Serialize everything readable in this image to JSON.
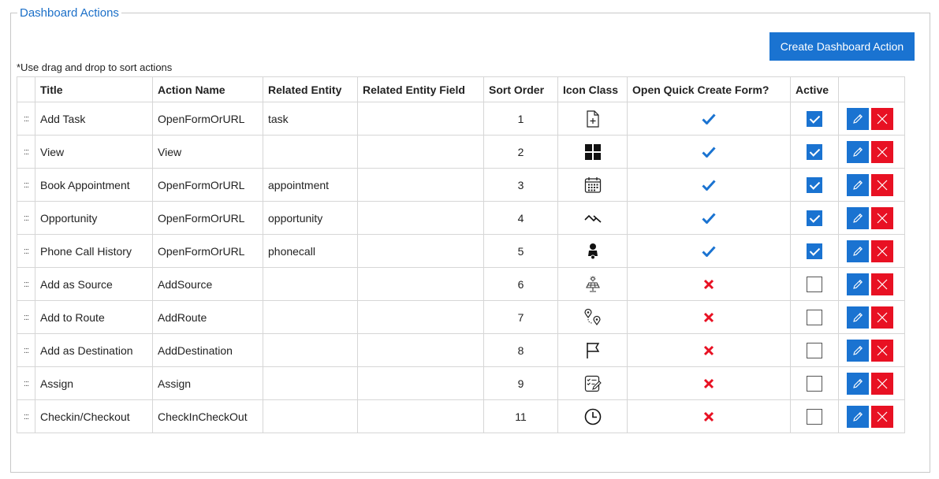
{
  "panel": {
    "title": "Dashboard Actions"
  },
  "toolbar": {
    "create_label": "Create Dashboard Action"
  },
  "hint": "*Use drag and drop to sort actions",
  "drag_glyph": ":::",
  "columns": {
    "title": "Title",
    "action_name": "Action Name",
    "related_entity": "Related Entity",
    "related_entity_field": "Related Entity Field",
    "sort_order": "Sort Order",
    "icon_class": "Icon Class",
    "quick_create": "Open Quick Create Form?",
    "active": "Active"
  },
  "colors": {
    "accent": "#1a73d1",
    "danger": "#e81123",
    "check": "#1a73d1",
    "cross": "#e81123"
  },
  "rows": [
    {
      "title": "Add Task",
      "action_name": "OpenFormOrURL",
      "related_entity": "task",
      "related_entity_field": "",
      "sort_order": "1",
      "icon": "task-add-icon",
      "quick_create": true,
      "active": true
    },
    {
      "title": "View",
      "action_name": "View",
      "related_entity": "",
      "related_entity_field": "",
      "sort_order": "2",
      "icon": "grid-tiles-icon",
      "quick_create": true,
      "active": true
    },
    {
      "title": "Book Appointment",
      "action_name": "OpenFormOrURL",
      "related_entity": "appointment",
      "related_entity_field": "",
      "sort_order": "3",
      "icon": "calendar-icon",
      "quick_create": true,
      "active": true
    },
    {
      "title": "Opportunity",
      "action_name": "OpenFormOrURL",
      "related_entity": "opportunity",
      "related_entity_field": "",
      "sort_order": "4",
      "icon": "trend-line-icon",
      "quick_create": true,
      "active": true
    },
    {
      "title": "Phone Call History",
      "action_name": "OpenFormOrURL",
      "related_entity": "phonecall",
      "related_entity_field": "",
      "sort_order": "5",
      "icon": "person-phone-icon",
      "quick_create": true,
      "active": true
    },
    {
      "title": "Add as Source",
      "action_name": "AddSource",
      "related_entity": "",
      "related_entity_field": "",
      "sort_order": "6",
      "icon": "solar-panel-icon",
      "quick_create": false,
      "active": false
    },
    {
      "title": "Add to Route",
      "action_name": "AddRoute",
      "related_entity": "",
      "related_entity_field": "",
      "sort_order": "7",
      "icon": "route-pins-icon",
      "quick_create": false,
      "active": false
    },
    {
      "title": "Add as Destination",
      "action_name": "AddDestination",
      "related_entity": "",
      "related_entity_field": "",
      "sort_order": "8",
      "icon": "flag-icon",
      "quick_create": false,
      "active": false
    },
    {
      "title": "Assign",
      "action_name": "Assign",
      "related_entity": "",
      "related_entity_field": "",
      "sort_order": "9",
      "icon": "task-list-edit-icon",
      "quick_create": false,
      "active": false
    },
    {
      "title": "Checkin/Checkout",
      "action_name": "CheckInCheckOut",
      "related_entity": "",
      "related_entity_field": "",
      "sort_order": "11",
      "icon": "clock-icon",
      "quick_create": false,
      "active": false
    }
  ]
}
